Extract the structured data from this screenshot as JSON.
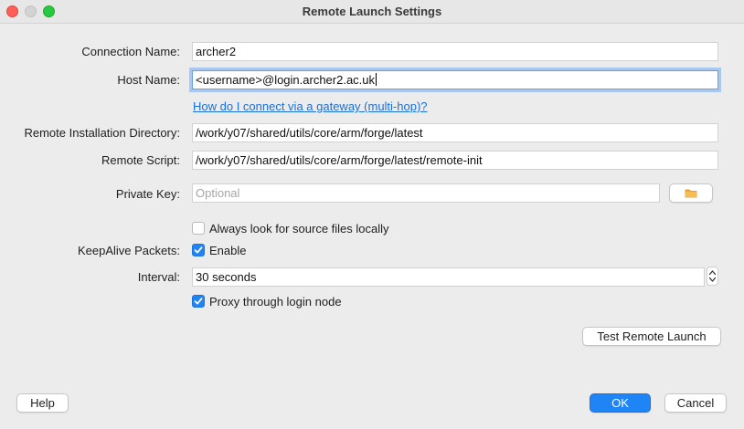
{
  "window": {
    "title": "Remote Launch Settings"
  },
  "form": {
    "connection_name_label": "Connection Name:",
    "connection_name_value": "archer2",
    "host_name_label": "Host Name:",
    "host_name_value": "<username>@login.archer2.ac.uk",
    "gateway_link": "How do I connect via a gateway (multi-hop)?",
    "install_dir_label": "Remote Installation Directory:",
    "install_dir_value": "/work/y07/shared/utils/core/arm/forge/latest",
    "remote_script_label": "Remote Script:",
    "remote_script_value": "/work/y07/shared/utils/core/arm/forge/latest/remote-init",
    "private_key_label": "Private Key:",
    "private_key_placeholder": "Optional",
    "private_key_browse_icon": "folder-icon",
    "always_local_label": "Always look for source files locally",
    "always_local_checked": false,
    "keepalive_label": "KeepAlive Packets:",
    "keepalive_enable_label": "Enable",
    "keepalive_enabled": true,
    "interval_label": "Interval:",
    "interval_value": "30 seconds",
    "proxy_label": "Proxy through login node",
    "proxy_checked": true
  },
  "buttons": {
    "test_remote_launch": "Test Remote Launch",
    "help": "Help",
    "ok": "OK",
    "cancel": "Cancel"
  },
  "colors": {
    "accent": "#1f84f5",
    "link": "#1b6fd8",
    "background": "#ececec"
  }
}
